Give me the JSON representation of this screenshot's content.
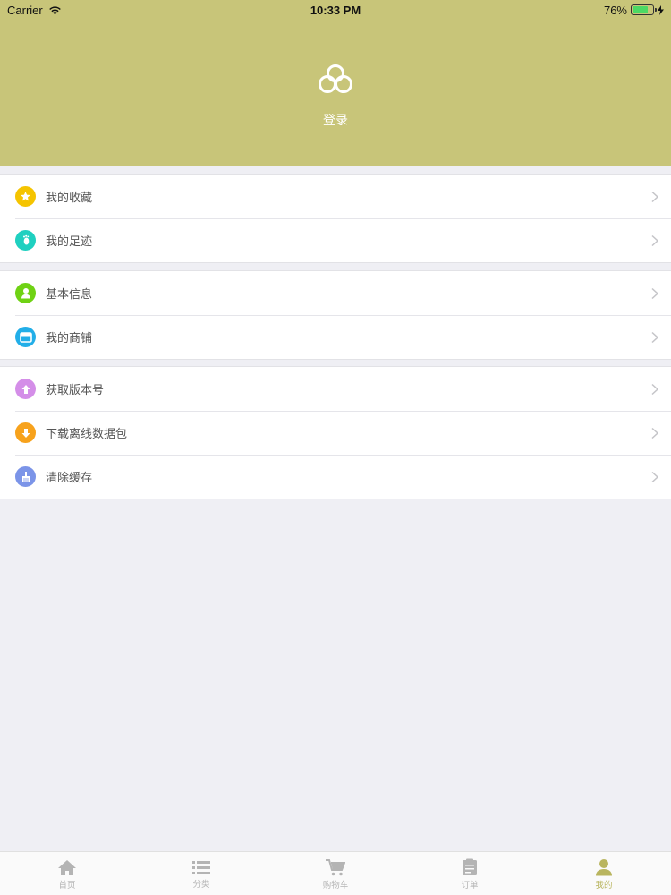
{
  "status_bar": {
    "carrier": "Carrier",
    "time": "10:33 PM",
    "battery": "76%",
    "battery_level": 0.76
  },
  "header": {
    "bg_color": "#c8c579",
    "login_label": "登录",
    "logo_icon": "three-rings-icon"
  },
  "groups": [
    {
      "items": [
        {
          "label": "我的收藏",
          "icon": "star-icon",
          "color": "#f5c400"
        },
        {
          "label": "我的足迹",
          "icon": "footprint-icon",
          "color": "#1fd0c0"
        }
      ]
    },
    {
      "items": [
        {
          "label": "基本信息",
          "icon": "user-icon",
          "color": "#6fd214"
        },
        {
          "label": "我的商铺",
          "icon": "store-icon",
          "color": "#22aee8"
        }
      ]
    },
    {
      "items": [
        {
          "label": "获取版本号",
          "icon": "upload-icon",
          "color": "#d48ee8"
        },
        {
          "label": "下载离线数据包",
          "icon": "download-icon",
          "color": "#f7a21c"
        },
        {
          "label": "清除缓存",
          "icon": "broom-icon",
          "color": "#7b94e8"
        }
      ]
    }
  ],
  "tabbar": {
    "tabs": [
      {
        "label": "首页",
        "icon": "home-icon",
        "active": false
      },
      {
        "label": "分类",
        "icon": "list-icon",
        "active": false
      },
      {
        "label": "购物车",
        "icon": "cart-icon",
        "active": false
      },
      {
        "label": "订单",
        "icon": "clipboard-icon",
        "active": false
      },
      {
        "label": "我的",
        "icon": "person-icon",
        "active": true
      }
    ],
    "active_color": "#b9b55f",
    "inactive_color": "#b4b4b4"
  }
}
